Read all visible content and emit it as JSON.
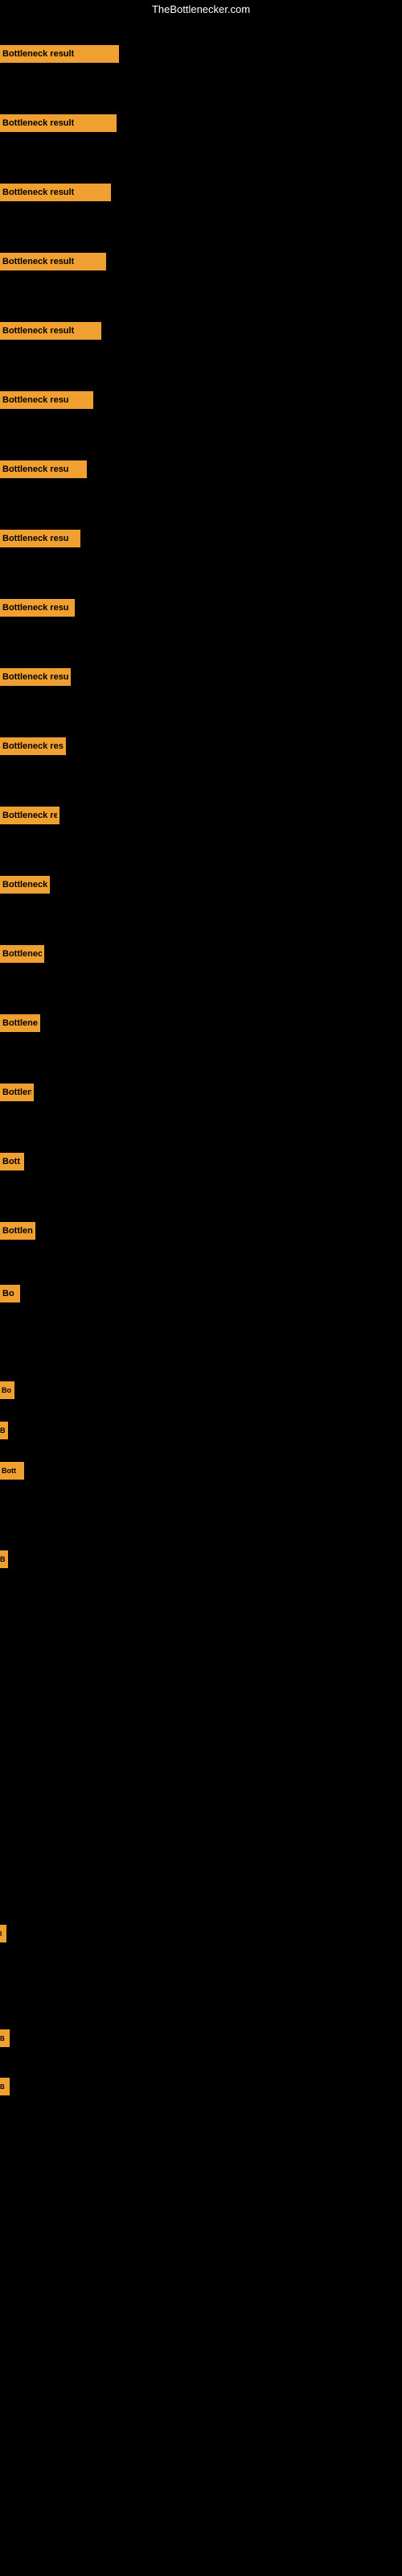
{
  "site": {
    "title": "TheBottlenecker.com"
  },
  "bars": [
    {
      "id": 1,
      "label": "Bottleneck result",
      "width": 148,
      "height": 22,
      "gap_after": 20
    },
    {
      "id": 2,
      "label": "Bottleneck result",
      "width": 145,
      "height": 22,
      "gap_after": 20
    },
    {
      "id": 3,
      "label": "Bottleneck result",
      "width": 138,
      "height": 22,
      "gap_after": 20
    },
    {
      "id": 4,
      "label": "Bottleneck result",
      "width": 132,
      "height": 22,
      "gap_after": 20
    },
    {
      "id": 5,
      "label": "Bottleneck result",
      "width": 126,
      "height": 22,
      "gap_after": 20
    },
    {
      "id": 6,
      "label": "Bottleneck resu",
      "width": 116,
      "height": 22,
      "gap_after": 20
    },
    {
      "id": 7,
      "label": "Bottleneck resu",
      "width": 108,
      "height": 22,
      "gap_after": 20
    },
    {
      "id": 8,
      "label": "Bottleneck resu",
      "width": 100,
      "height": 22,
      "gap_after": 20
    },
    {
      "id": 9,
      "label": "Bottleneck resu",
      "width": 93,
      "height": 22,
      "gap_after": 20
    },
    {
      "id": 10,
      "label": "Bottleneck resu",
      "width": 88,
      "height": 22,
      "gap_after": 20
    },
    {
      "id": 11,
      "label": "Bottleneck resu",
      "width": 82,
      "height": 22,
      "gap_after": 20
    },
    {
      "id": 12,
      "label": "Bottleneck res",
      "width": 74,
      "height": 22,
      "gap_after": 20
    },
    {
      "id": 13,
      "label": "Bottleneck re",
      "width": 62,
      "height": 22,
      "gap_after": 20
    },
    {
      "id": 14,
      "label": "Bottleneck re",
      "width": 55,
      "height": 22,
      "gap_after": 20
    },
    {
      "id": 15,
      "label": "Bottleneck re",
      "width": 50,
      "height": 22,
      "gap_after": 20
    },
    {
      "id": 16,
      "label": "Bottlenec",
      "width": 42,
      "height": 22,
      "gap_after": 20
    },
    {
      "id": 17,
      "label": "Bott",
      "width": 30,
      "height": 22,
      "gap_after": 20
    },
    {
      "id": 18,
      "label": "Bottlen",
      "width": 44,
      "height": 22,
      "gap_after": 20
    },
    {
      "id": 19,
      "label": "Bo",
      "width": 25,
      "height": 22,
      "gap_after": 60
    },
    {
      "id": 20,
      "label": "",
      "width": 0,
      "height": 22,
      "gap_after": 10
    },
    {
      "id": 21,
      "label": "Bo",
      "width": 18,
      "height": 22,
      "gap_after": 10
    },
    {
      "id": 22,
      "label": "B",
      "width": 10,
      "height": 22,
      "gap_after": 10
    },
    {
      "id": 23,
      "label": "Bott",
      "width": 30,
      "height": 22,
      "gap_after": 60
    },
    {
      "id": 24,
      "label": "",
      "width": 0,
      "height": 22,
      "gap_after": 10
    },
    {
      "id": 25,
      "label": "B",
      "width": 10,
      "height": 22,
      "gap_after": 200
    }
  ],
  "bottom_bars": [
    {
      "id": "b1",
      "label": "",
      "width": 0,
      "gap_after": 200
    },
    {
      "id": "b2",
      "label": "I",
      "width": 8,
      "gap_after": 20
    },
    {
      "id": "b3",
      "label": "",
      "width": 0,
      "gap_after": 20
    },
    {
      "id": "b4",
      "label": "B",
      "width": 12,
      "gap_after": 20
    },
    {
      "id": "b5",
      "label": "B",
      "width": 12,
      "gap_after": 20
    }
  ]
}
